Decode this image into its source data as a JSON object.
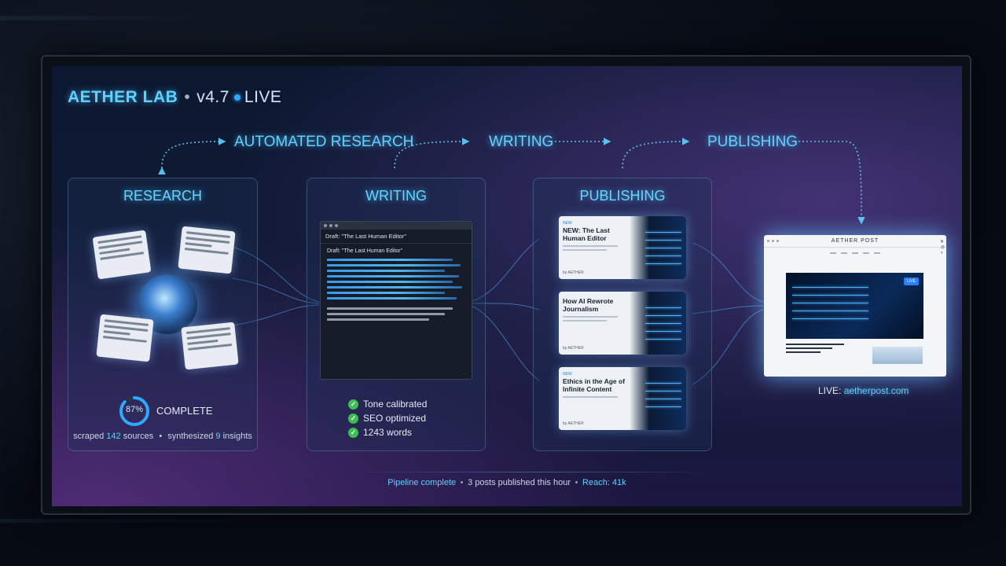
{
  "header": {
    "app_name": "AETHER LAB",
    "version": "v4.7",
    "status": "LIVE"
  },
  "flow": {
    "labels": [
      "AUTOMATED RESEARCH",
      "WRITING",
      "PUBLISHING"
    ]
  },
  "research": {
    "title": "RESEARCH",
    "progress_value": 0.87,
    "progress_text": "87%",
    "complete_label": "COMPLETE",
    "stats": {
      "scraped_prefix": "scraped",
      "sources": "142",
      "sources_label": "sources",
      "synth_prefix": "synthesized",
      "insights": "9",
      "insights_label": "insights"
    }
  },
  "writing": {
    "title": "WRITING",
    "editor_header": "Draft: \"The Last Human Editor\"",
    "editor_draft": "Draft: \"The Last Human Editor\"",
    "checks": [
      "Tone calibrated",
      "SEO optimized",
      "1243 words"
    ]
  },
  "publishing": {
    "title": "PUBLISHING",
    "posts": [
      {
        "tag": "NEW",
        "title": "NEW: The Last Human Editor",
        "byline": "by AETHER"
      },
      {
        "tag": "",
        "title": "How AI Rewrote Journalism",
        "byline": "by AETHER"
      },
      {
        "tag": "NEW",
        "title": "Ethics in the Age of Infinite Content",
        "byline": "by AETHER"
      }
    ]
  },
  "live_site": {
    "name": "AETHER POST",
    "badge": "LIVE",
    "url_label": "LIVE:",
    "url": "aetherpost.com"
  },
  "footer": {
    "pipeline": "Pipeline complete",
    "posts": "3 posts published this hour",
    "reach_label": "Reach:",
    "reach": "41k"
  },
  "colors": {
    "accent": "#5fd0ff",
    "success": "#3bbf4e",
    "live_dot": "#2fa8ff"
  }
}
